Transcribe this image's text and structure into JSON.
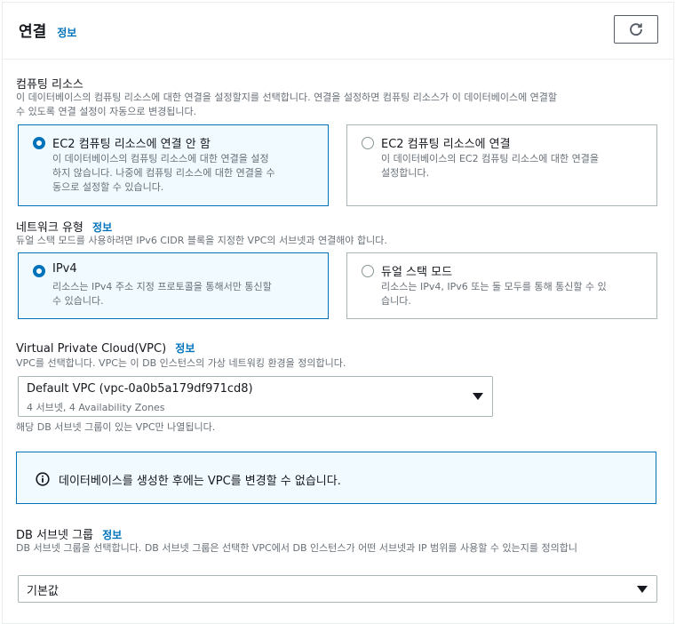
{
  "section": {
    "title": "연결",
    "info": "정보",
    "refresh_icon": "refresh-icon"
  },
  "compute": {
    "label": "컴퓨팅 리소스",
    "desc_line1": "이 데이터베이스의 컴퓨팅 리소스에 대한 연결을 설정할지를 선택합니다. 연결을 설정하면 컴퓨팅 리소스가 이 데이터베이스에 연결할",
    "desc_line2": "수 있도록 연결 설정이 자동으로 변경됩니다.",
    "options": [
      {
        "title": "EC2 컴퓨팅 리소스에 연결 안 함",
        "desc_line1": "이 데이터베이스의 컴퓨팅 리소스에 대한 연결을 설정",
        "desc_line2": "하지 않습니다. 나중에 컴퓨팅 리소스에 대한 연결을 수",
        "desc_line3": "동으로 설정할 수 있습니다.",
        "selected": true
      },
      {
        "title": "EC2 컴퓨팅 리소스에 연결",
        "desc_line1": "이 데이터베이스의 EC2 컴퓨팅 리소스에 대한 연결을",
        "desc_line2": "설정합니다.",
        "selected": false
      }
    ]
  },
  "network": {
    "label": "네트워크 유형",
    "info": "정보",
    "desc": "듀얼 스택 모드를 사용하려면 IPv6 CIDR 블록을 지정한 VPC의 서브넷과 연결해야 합니다.",
    "options": [
      {
        "title": "IPv4",
        "desc_line1": "리소스는 IPv4 주소 지정 프로토콜을 통해서만 통신할",
        "desc_line2": "수 있습니다.",
        "selected": true
      },
      {
        "title": "듀얼 스택 모드",
        "desc_line1": "리소스는 IPv4, IPv6 또는 둘 모두를 통해 통신할 수 있",
        "desc_line2": "습니다.",
        "selected": false
      }
    ]
  },
  "vpc": {
    "label": "Virtual Private Cloud(VPC)",
    "info": "정보",
    "desc": "VPC를 선택합니다. VPC는 이 DB 인스턴스의 가상 네트워킹 환경을 정의합니다.",
    "value": "Default VPC (vpc-0a0b5a179df971cd8)",
    "sub": "4 서브넷, 4 Availability Zones",
    "hint": "해당 DB 서브넷 그룹이 있는 VPC만 나열됩니다."
  },
  "alert": {
    "text": "데이터베이스를 생성한 후에는 VPC를 변경할 수 없습니다.",
    "icon": "info-circle-icon",
    "accent": "#0073bb"
  },
  "subnet": {
    "label": "DB 서브넷 그룹",
    "info": "정보",
    "desc": "DB 서브넷 그룹을 선택합니다. DB 서브넷 그룹은 선택한 VPC에서 DB 인스턴스가 어떤 서브넷과 IP 범위를 사용할 수 있는지를 정의합니",
    "value": "기본값"
  }
}
